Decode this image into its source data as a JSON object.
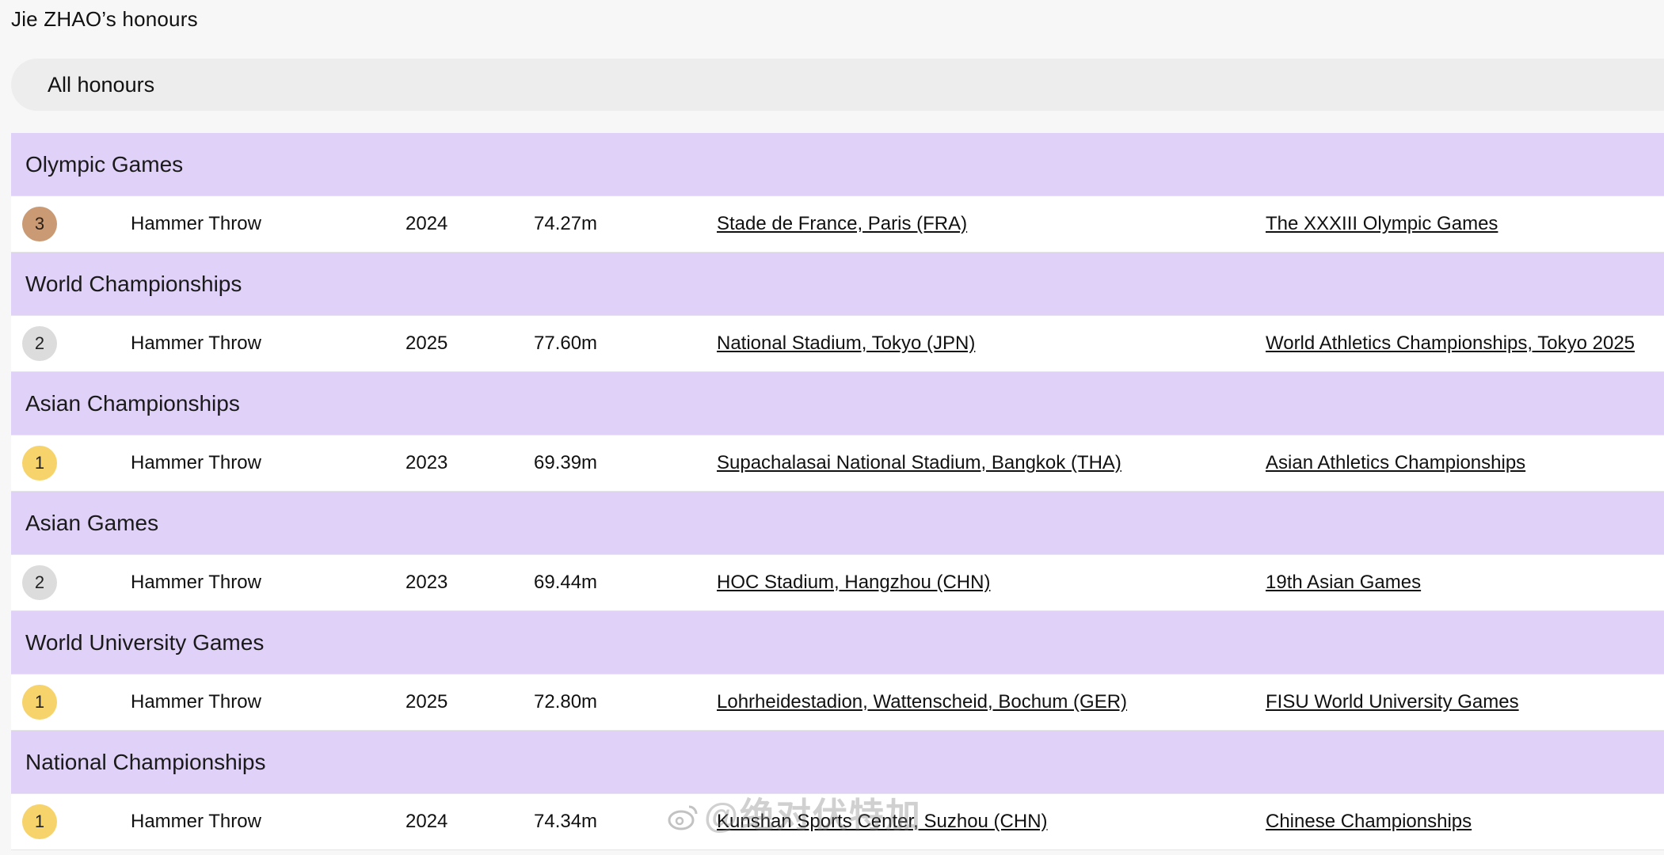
{
  "page": {
    "title": "Jie ZHAO’s honours"
  },
  "filter": {
    "label": "All honours"
  },
  "colors": {
    "section_header_bg": "#e0d1f8",
    "gold": "#f7d36b",
    "silver": "#dcdcdc",
    "bronze": "#c99a73"
  },
  "sections": [
    {
      "title": "Olympic Games",
      "row": {
        "place": "3",
        "medal": "bronze",
        "event": "Hammer Throw",
        "year": "2024",
        "mark": "74.27m",
        "venue": "Stade de France, Paris (FRA)",
        "competition": "The XXXIII Olympic Games"
      }
    },
    {
      "title": "World Championships",
      "row": {
        "place": "2",
        "medal": "silver",
        "event": "Hammer Throw",
        "year": "2025",
        "mark": "77.60m",
        "venue": "National Stadium, Tokyo (JPN)",
        "competition": "World Athletics Championships, Tokyo 2025"
      }
    },
    {
      "title": "Asian Championships",
      "row": {
        "place": "1",
        "medal": "gold",
        "event": "Hammer Throw",
        "year": "2023",
        "mark": "69.39m",
        "venue": "Supachalasai National Stadium, Bangkok (THA)",
        "competition": "Asian Athletics Championships"
      }
    },
    {
      "title": "Asian Games",
      "row": {
        "place": "2",
        "medal": "silver",
        "event": "Hammer Throw",
        "year": "2023",
        "mark": "69.44m",
        "venue": "HOC Stadium, Hangzhou (CHN)",
        "competition": "19th Asian Games"
      }
    },
    {
      "title": "World University Games",
      "row": {
        "place": "1",
        "medal": "gold",
        "event": "Hammer Throw",
        "year": "2025",
        "mark": "72.80m",
        "venue": "Lohrheidestadion, Wattenscheid, Bochum (GER)",
        "competition": "FISU World University Games"
      }
    },
    {
      "title": "National Championships",
      "row": {
        "place": "1",
        "medal": "gold",
        "event": "Hammer Throw",
        "year": "2024",
        "mark": "74.34m",
        "venue": "Kunshan Sports Center, Suzhou (CHN)",
        "competition": "Chinese Championships"
      }
    }
  ],
  "watermark": {
    "text": "@绝对伏特加",
    "icon": "weibo-logo-icon"
  }
}
